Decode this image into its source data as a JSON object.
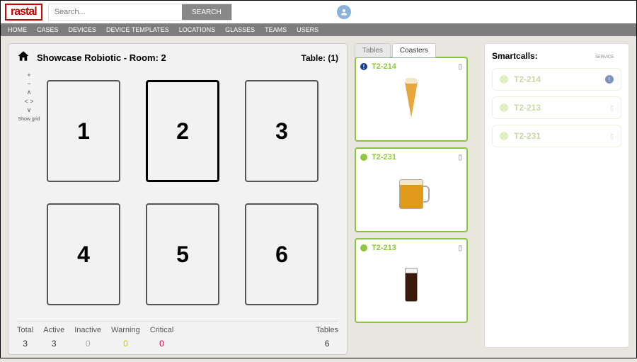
{
  "logo": "rastal",
  "search": {
    "placeholder": "Search...",
    "button": "SEARCH"
  },
  "nav": [
    "HOME",
    "CASES",
    "DEVICES",
    "DEVICE TEMPLATES",
    "LOCATIONS",
    "GLASSES",
    "TEAMS",
    "USERS"
  ],
  "panel": {
    "title": "Showcase Robiotic - Room: 2",
    "table_label": "Table: (1)",
    "controls_showgrid": "Show grid",
    "tables": [
      "1",
      "2",
      "3",
      "4",
      "5",
      "6"
    ],
    "selected_index": 1
  },
  "stats": {
    "labels": {
      "total": "Total",
      "active": "Active",
      "inactive": "Inactive",
      "warning": "Warning",
      "critical": "Critical",
      "tables": "Tables"
    },
    "values": {
      "total": "3",
      "active": "3",
      "inactive": "0",
      "warning": "0",
      "critical": "0",
      "tables": "6"
    }
  },
  "tabs": {
    "tables": "Tables",
    "coasters": "Coasters"
  },
  "coasters": [
    {
      "id": "T2-214",
      "status": "alert",
      "drink": "pilsner"
    },
    {
      "id": "T2-231",
      "status": "ok",
      "drink": "mug"
    },
    {
      "id": "T2-213",
      "status": "ok",
      "drink": "cola"
    }
  ],
  "smart": {
    "title": "Smartcalls:",
    "service_label": "SERVICE",
    "items": [
      {
        "id": "T2-214",
        "icon": "alert"
      },
      {
        "id": "T2-213",
        "icon": "battery"
      },
      {
        "id": "T2-231",
        "icon": "battery"
      }
    ]
  }
}
